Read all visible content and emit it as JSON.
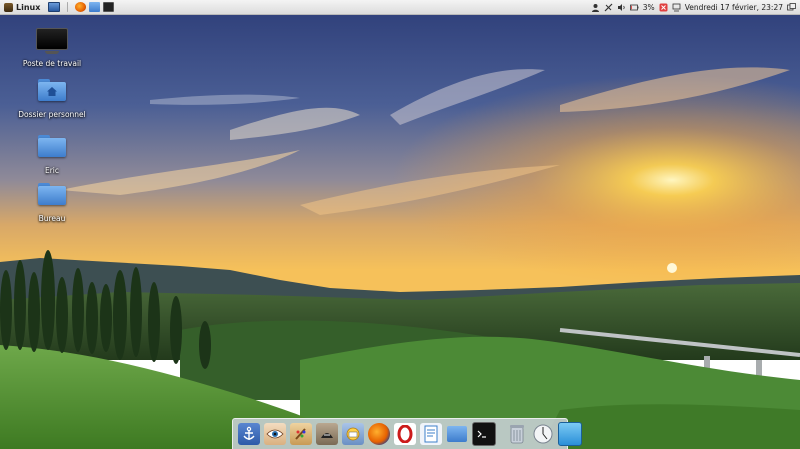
{
  "top_panel": {
    "menu_label": "Linux",
    "quick_launch": [
      {
        "icon": "desktop-icon",
        "color": "#3a6fb0"
      },
      {
        "icon": "firefox-icon",
        "color": "#e66000"
      },
      {
        "icon": "folder-icon",
        "color": "#4a86d4"
      },
      {
        "icon": "terminal-icon",
        "color": "#222222"
      }
    ],
    "tray": {
      "battery_text": "3%",
      "clock": "Vendredi 17 février, 23:27"
    }
  },
  "desktop_icons": [
    {
      "label": "Poste de travail",
      "icon": "computer-icon"
    },
    {
      "label": "Dossier personnel",
      "icon": "home-folder-icon"
    },
    {
      "label": "Eric",
      "icon": "folder-icon"
    },
    {
      "label": "Bureau",
      "icon": "folder-icon"
    }
  ],
  "dock": {
    "items": [
      {
        "icon": "anchor-icon",
        "color": "#2c5aa8"
      },
      {
        "icon": "eye-icon",
        "color": "#d9b080"
      },
      {
        "icon": "paint-icon",
        "color": "#c89a55"
      },
      {
        "icon": "inkscape-icon",
        "color": "#7a6a55"
      },
      {
        "icon": "mail-icon",
        "color": "#6a8fc4"
      },
      {
        "icon": "firefox-icon",
        "color": "#e66000"
      },
      {
        "icon": "opera-icon",
        "color": "#cc1b1b"
      },
      {
        "icon": "writer-icon",
        "color": "#3d7fc9"
      },
      {
        "icon": "folder-icon",
        "color": "#4a86d4"
      },
      {
        "icon": "terminal-icon",
        "color": "#111111"
      },
      {
        "icon": "trash-icon",
        "color": "#9aa4b0"
      },
      {
        "icon": "clock-icon",
        "color": "#d8dde3"
      },
      {
        "icon": "show-desktop-icon",
        "color": "#3aa0e0"
      }
    ]
  }
}
